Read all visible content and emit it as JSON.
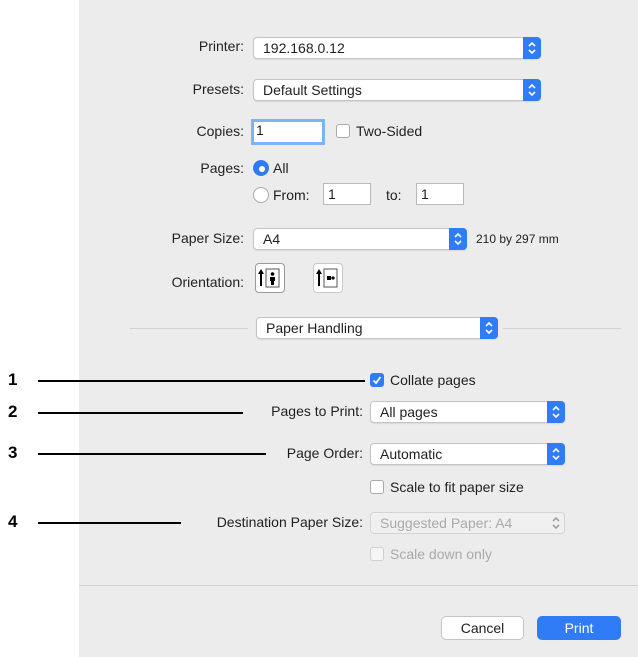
{
  "printer": {
    "label": "Printer:",
    "value": "192.168.0.12"
  },
  "presets": {
    "label": "Presets:",
    "value": "Default Settings"
  },
  "copies": {
    "label": "Copies:",
    "value": "1",
    "two_sided_label": "Two-Sided"
  },
  "pages": {
    "label": "Pages:",
    "all_label": "All",
    "from_label": "From:",
    "from_value": "1",
    "to_label": "to:",
    "to_value": "1"
  },
  "paper_size": {
    "label": "Paper Size:",
    "value": "A4",
    "dimensions": "210 by 297 mm"
  },
  "orientation": {
    "label": "Orientation:",
    "portrait_icon": "portrait-orientation-icon",
    "landscape_icon": "landscape-orientation-icon"
  },
  "section": {
    "value": "Paper Handling"
  },
  "collate": {
    "label": "Collate pages",
    "checked": true
  },
  "pages_to_print": {
    "label": "Pages to Print:",
    "value": "All pages"
  },
  "page_order": {
    "label": "Page Order:",
    "value": "Automatic"
  },
  "scale_to_fit": {
    "label": "Scale to fit paper size",
    "checked": false
  },
  "destination_paper_size": {
    "label": "Destination Paper Size:",
    "value": "Suggested Paper: A4",
    "disabled": true
  },
  "scale_down_only": {
    "label": "Scale down only",
    "checked": false,
    "disabled": true
  },
  "buttons": {
    "cancel": "Cancel",
    "print": "Print"
  },
  "callouts": [
    "1",
    "2",
    "3",
    "4"
  ],
  "colors": {
    "accent": "#2f7cf6",
    "dialog_bg": "#ececec"
  }
}
